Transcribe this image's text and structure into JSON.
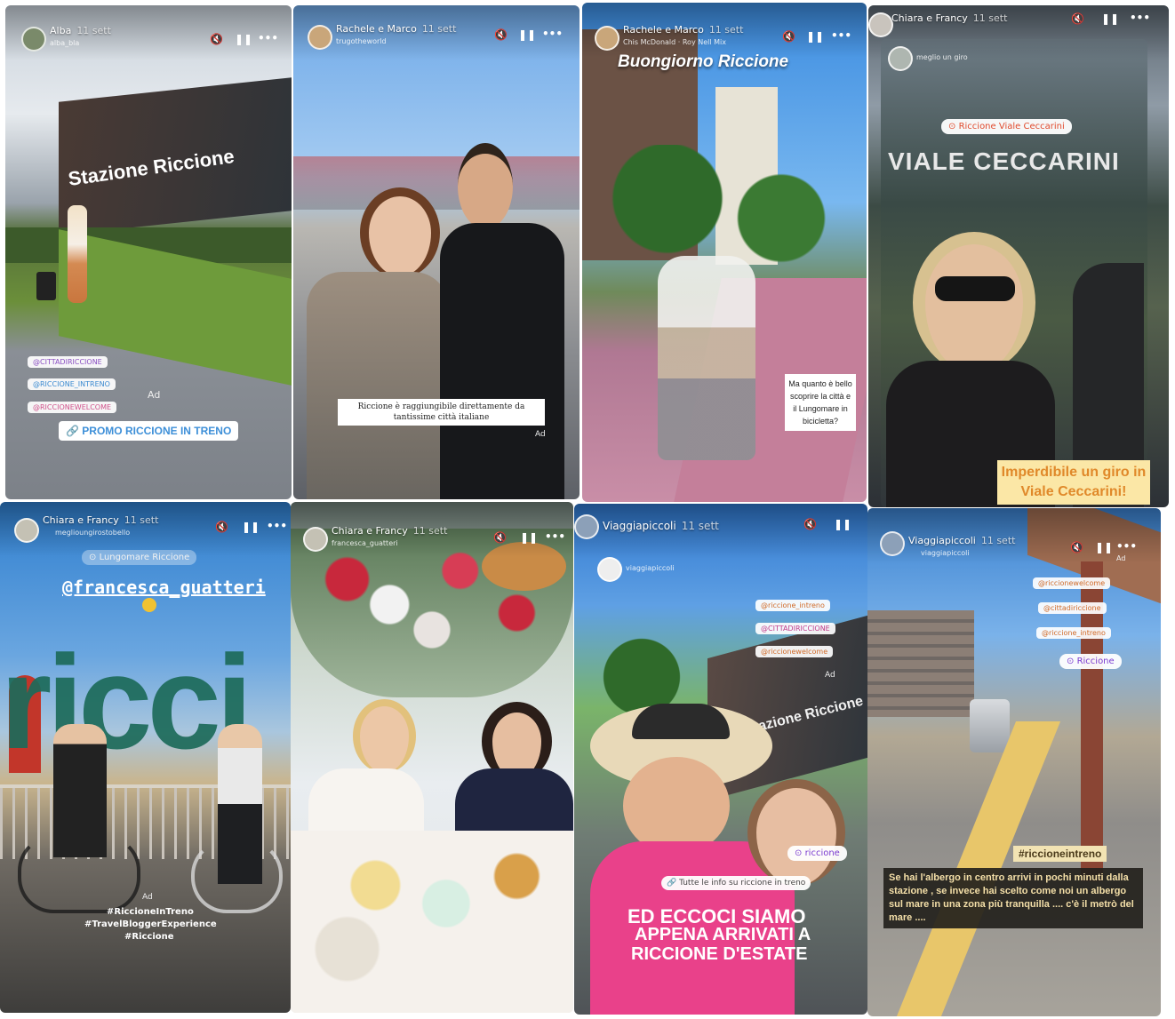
{
  "stories": [
    {
      "user": "Alba",
      "time": "11 sett",
      "sub": "alba_bla",
      "station_sign": "Stazione Riccione",
      "hashtags": [
        "@CITTADIRICCIONE",
        "@RICCIONE_INTRENO",
        "@RICCIONEWELCOME"
      ],
      "ad": "Ad",
      "promo": "PROMO RICCIONE IN TRENO"
    },
    {
      "user": "Rachele e Marco",
      "time": "11 sett",
      "sub": "trugotheworld",
      "caption": "Riccione è raggiungibile direttamente da tantissime città italiane",
      "ad": "Ad"
    },
    {
      "user": "Rachele e Marco",
      "time": "11 sett",
      "sub": "Chis McDonald · Roy Nell Mix",
      "title": "Buongiorno Riccione",
      "caption": "Ma quanto è bello scoprire la città e il Lungomare in bicicletta?"
    },
    {
      "user": "Chiara e Francy",
      "time": "11 sett",
      "sub": "meglio un giro",
      "location": "Riccione Viale Ceccarini",
      "sign": "VIALE CECCARINI",
      "caption": "Imperdibile un giro in Viale Ceccarini!"
    },
    {
      "user": "Chiara e Francy",
      "time": "11 sett",
      "sub": "meglioungirostobello",
      "location": "Lungomare Riccione",
      "mention": "@francesca_guatteri",
      "letters": "ricci",
      "ad": "Ad",
      "tags": [
        "#RiccioneInTreno",
        "#TravelBloggerExperience",
        "#Riccione"
      ]
    },
    {
      "user": "Chiara e Francy",
      "time": "11 sett",
      "sub": "francesca_guatteri"
    },
    {
      "user": "Viaggiapiccoli",
      "time": "11 sett",
      "sub": "viaggiapiccoli",
      "tags": [
        "@riccione_intreno",
        "@CITTADIRICCIONE",
        "@riccionewelcome"
      ],
      "ad": "Ad",
      "station_sign": "Stazione Riccione",
      "location": "riccione",
      "link": "Tutte le info su riccione in treno",
      "caption_lines": [
        "ED ECCOCI SIAMO",
        "APPENA ARRIVATI A",
        "RICCIONE D'ESTATE"
      ]
    },
    {
      "user": "Viaggiapiccoli",
      "time": "11 sett",
      "sub": "viaggiapiccoli",
      "ad": "Ad",
      "tags": [
        "@riccionewelcome",
        "@cittadiriccione",
        "@riccione_intreno"
      ],
      "location": "Riccione",
      "hashtag": "#riccioneintreno",
      "caption": "Se hai l'albergo in centro arrivi in pochi minuti dalla stazione , se invece hai scelto come noi un albergo sul mare in una zona più tranquilla .... c'è il metrò del mare ...."
    }
  ],
  "controls": {
    "mute": "🔇",
    "pause": "❚❚",
    "more": "•••"
  }
}
